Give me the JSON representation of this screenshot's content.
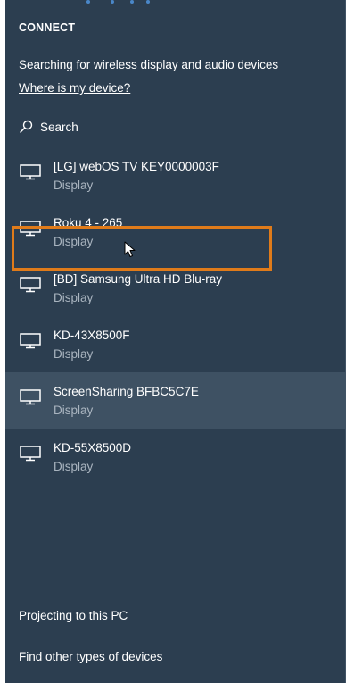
{
  "panel": {
    "title": "CONNECT",
    "status": "Searching for wireless display and audio devices",
    "where_link": "Where is my device?",
    "search_label": "Search"
  },
  "devices": [
    {
      "name": "[LG] webOS TV KEY0000003F",
      "type": "Display"
    },
    {
      "name": "Roku 4 - 265",
      "type": "Display"
    },
    {
      "name": "[BD] Samsung Ultra HD Blu-ray",
      "type": "Display"
    },
    {
      "name": "KD-43X8500F",
      "type": "Display"
    },
    {
      "name": "ScreenSharing BFBC5C7E",
      "type": "Display"
    },
    {
      "name": "KD-55X8500D",
      "type": "Display"
    }
  ],
  "footer": {
    "projecting_link": "Projecting to this PC",
    "other_devices_link": "Find other types of devices"
  },
  "icons": {
    "search": "search-icon",
    "device": "monitor-icon",
    "pointer": "mouse-cursor-icon"
  },
  "colors": {
    "panel_bg": "#2c3e50",
    "hover_bg": "#3e5163",
    "highlight": "#e07b1a",
    "secondary_text": "#a9b4bf"
  }
}
